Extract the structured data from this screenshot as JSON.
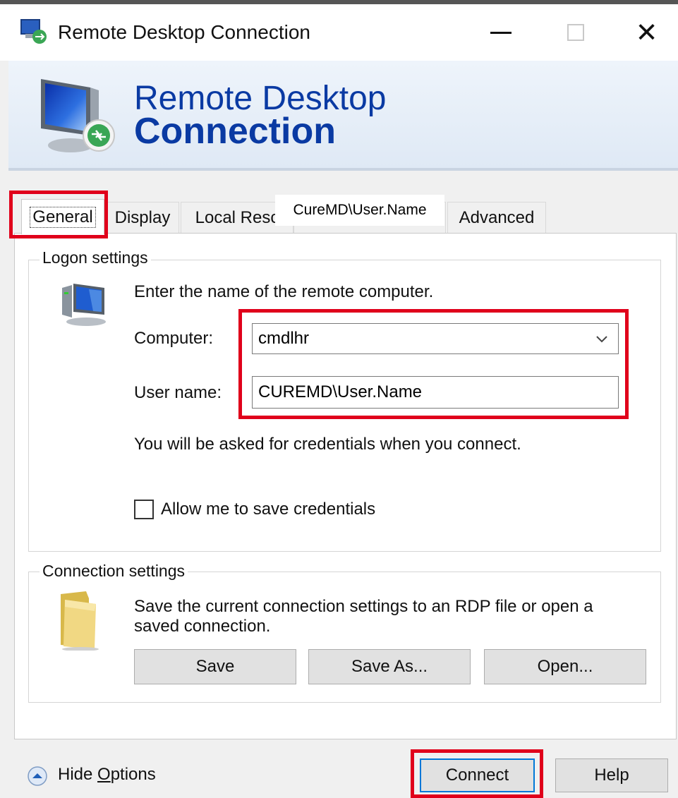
{
  "window": {
    "title": "Remote Desktop Connection",
    "minimize_glyph": "—",
    "close_glyph": "✕"
  },
  "banner": {
    "line1": "Remote Desktop",
    "line2": "Connection"
  },
  "tabs": [
    {
      "label": "General",
      "active": true
    },
    {
      "label": "Display"
    },
    {
      "label": "Local Resc"
    },
    {
      "label": "Advanced"
    }
  ],
  "tab_overlay_text": "CureMD\\User.Name",
  "logon": {
    "group_title": "Logon settings",
    "instruction": "Enter the name of the remote computer.",
    "computer_label": "Computer:",
    "computer_value": "cmdlhr",
    "username_label": "User name:",
    "username_value": "CUREMD\\User.Name",
    "credentials_note": "You will be asked for credentials when you connect.",
    "allow_save_label": "Allow me to save credentials",
    "allow_save_checked": false
  },
  "connection": {
    "group_title": "Connection settings",
    "description_line1": "Save the current connection settings to an RDP file or open a",
    "description_line2": "saved connection.",
    "save_label": "Save",
    "save_as_label": "Save As...",
    "open_label": "Open..."
  },
  "footer": {
    "hide_options_prefix": "Hide ",
    "hide_options_accel": "O",
    "hide_options_suffix": "ptions",
    "connect_label": "Connect",
    "help_label": "Help"
  },
  "colors": {
    "highlight": "#e0001b",
    "banner_text": "#0a3aa3",
    "window_bg": "#f0f0f0"
  },
  "icons": [
    "rdp-app-icon",
    "rdp-monitor-icon",
    "computer-icon",
    "folder-icon",
    "chevron-down-icon",
    "collapse-arrow-icon"
  ]
}
